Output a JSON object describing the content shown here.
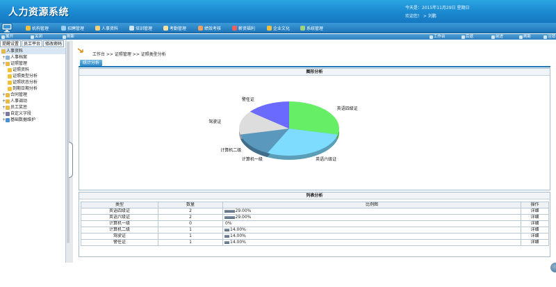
{
  "header": {
    "app_title": "人力资源系统",
    "date_line": "今天是：2015年11月29日  星期日",
    "welcome_line": "欢迎您！ > 刘鹏"
  },
  "nav": {
    "items": [
      {
        "label": "机构管理",
        "icon": "org-icon",
        "color": "#f0c040"
      },
      {
        "label": "招聘管理",
        "icon": "recruit-icon",
        "color": "#9ad0f5"
      },
      {
        "label": "人事资料",
        "icon": "people-icon",
        "color": "#f6d27a"
      },
      {
        "label": "培训管理",
        "icon": "training-icon",
        "color": "#cfe3f3"
      },
      {
        "label": "考勤管理",
        "icon": "attendance-icon",
        "color": "#f7e1a0"
      },
      {
        "label": "绩效考核",
        "icon": "performance-icon",
        "color": "#f0a060"
      },
      {
        "label": "薪资福利",
        "icon": "salary-icon",
        "color": "#e86060"
      },
      {
        "label": "企业文化",
        "icon": "culture-icon",
        "color": "#f0c040"
      },
      {
        "label": "系统管理",
        "icon": "system-icon",
        "color": "#a0d080"
      }
    ]
  },
  "subbar": {
    "left": [
      {
        "label": "展开",
        "icon": "expand-icon"
      },
      {
        "label": "关闭",
        "icon": "collapse-icon"
      },
      {
        "label": "刷新",
        "icon": "refresh-icon"
      }
    ],
    "right": [
      {
        "label": "工作台",
        "icon": "workbench-icon"
      },
      {
        "label": "后退",
        "icon": "back-icon"
      },
      {
        "label": "前进",
        "icon": "forward-icon"
      },
      {
        "label": "刷新",
        "icon": "reload-icon"
      },
      {
        "label": "注销",
        "icon": "logout-icon"
      }
    ]
  },
  "sidebar": {
    "tabs": [
      "提醒设置",
      "员工平台",
      "修改密码"
    ],
    "tree": [
      {
        "label": "人事资料",
        "level": 0,
        "icon": "folder-icon",
        "sel": true
      },
      {
        "label": "人事档案",
        "level": 1,
        "icon": "file-icon"
      },
      {
        "label": "证照管理",
        "level": 1,
        "icon": "folder-icon"
      },
      {
        "label": "证照资料",
        "level": 2,
        "icon": "star-icon"
      },
      {
        "label": "证照类型分析",
        "level": 2,
        "icon": "star-icon"
      },
      {
        "label": "证照状态分析",
        "level": 2,
        "icon": "star-icon"
      },
      {
        "label": "到期日期分析",
        "level": 2,
        "icon": "star-icon"
      },
      {
        "label": "合同管理",
        "level": 1,
        "icon": "folder-icon"
      },
      {
        "label": "人事调动",
        "level": 1,
        "icon": "folder-icon"
      },
      {
        "label": "员工奖惩",
        "level": 1,
        "icon": "folder-icon"
      },
      {
        "label": "自定义字段",
        "level": 1,
        "icon": "gear-icon"
      },
      {
        "label": "基础数据维护",
        "level": 1,
        "icon": "db-icon"
      }
    ]
  },
  "main": {
    "breadcrumb": "工作台 >> 证照管理 >> 证照类型分析",
    "tab_label": "统计分析",
    "graph_title": "图形分析",
    "list_title": "列表分析"
  },
  "chart_data": {
    "type": "pie",
    "labels": [
      "英语四级证",
      "英语六级证",
      "计算机一级",
      "计算机二级",
      "驾驶证",
      "警任证"
    ],
    "values": [
      2,
      2,
      0,
      1,
      1,
      1
    ],
    "colors": [
      "#66ee66",
      "#7ddcff",
      "#7aa6c8",
      "#5a98bd",
      "#dddddd",
      "#6a6aff"
    ]
  },
  "table": {
    "headers": [
      "类型",
      "数量",
      "比例图",
      "操作"
    ],
    "rows": [
      {
        "type": "英语四级证",
        "count": "2",
        "pct_text": "29.00%",
        "pct": 29,
        "action": "详细"
      },
      {
        "type": "英语六级证",
        "count": "2",
        "pct_text": "29.00%",
        "pct": 29,
        "action": "详细"
      },
      {
        "type": "计算机一级",
        "count": "0",
        "pct_text": "0%",
        "pct": 0,
        "action": "详细"
      },
      {
        "type": "计算机二级",
        "count": "1",
        "pct_text": "14.00%",
        "pct": 14,
        "action": "详细"
      },
      {
        "type": "驾驶证",
        "count": "1",
        "pct_text": "14.00%",
        "pct": 14,
        "action": "详细"
      },
      {
        "type": "警任证",
        "count": "1",
        "pct_text": "14.00%",
        "pct": 14,
        "action": "详细"
      }
    ]
  }
}
